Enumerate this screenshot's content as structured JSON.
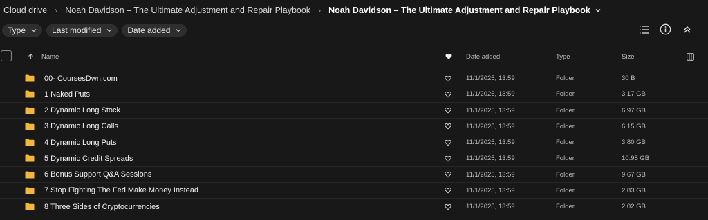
{
  "breadcrumb": {
    "root": "Cloud drive",
    "parent": "Noah Davidson – The Ultimate Adjustment and Repair Playbook",
    "current": "Noah Davidson – The Ultimate Adjustment and Repair Playbook"
  },
  "filters": {
    "type": "Type",
    "last_modified": "Last modified",
    "date_added": "Date added"
  },
  "columns": {
    "name": "Name",
    "date_added": "Date added",
    "type": "Type",
    "size": "Size"
  },
  "colors": {
    "background": "#181818",
    "folder": "#f4b73a",
    "chip": "#2e2e2e"
  },
  "rows": [
    {
      "name": "00- CoursesDwn.com",
      "date": "11/1/2025, 13:59",
      "type": "Folder",
      "size": "30 B"
    },
    {
      "name": "1 Naked Puts",
      "date": "11/1/2025, 13:59",
      "type": "Folder",
      "size": "3.17 GB"
    },
    {
      "name": "2 Dynamic Long Stock",
      "date": "11/1/2025, 13:59",
      "type": "Folder",
      "size": "6.97 GB"
    },
    {
      "name": "3 Dynamic Long Calls",
      "date": "11/1/2025, 13:59",
      "type": "Folder",
      "size": "6.15 GB"
    },
    {
      "name": "4 Dynamic Long Puts",
      "date": "11/1/2025, 13:59",
      "type": "Folder",
      "size": "3.80 GB"
    },
    {
      "name": "5 Dynamic Credit Spreads",
      "date": "11/1/2025, 13:59",
      "type": "Folder",
      "size": "10.95 GB"
    },
    {
      "name": "6 Bonus Support Q&A Sessions",
      "date": "11/1/2025, 13:59",
      "type": "Folder",
      "size": "9.67 GB"
    },
    {
      "name": "7 Stop Fighting The Fed Make Money Instead",
      "date": "11/1/2025, 13:59",
      "type": "Folder",
      "size": "2.83 GB"
    },
    {
      "name": "8 Three Sides of Cryptocurrencies",
      "date": "11/1/2025, 13:59",
      "type": "Folder",
      "size": "2.02 GB"
    }
  ]
}
